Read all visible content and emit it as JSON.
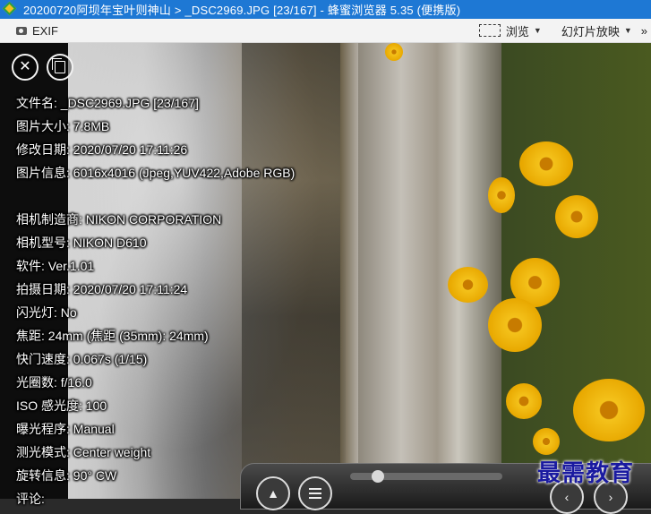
{
  "window": {
    "title": "20200720阿坝年宝叶则神山 > _DSC2969.JPG [23/167] - 蜂蜜浏览器 5.35 (便携版)"
  },
  "toolbar": {
    "exif_label": "EXIF",
    "browse_label": "浏览",
    "slideshow_label": "幻灯片放映",
    "more_label": "»"
  },
  "overlay": {
    "close_icon": "✕",
    "copy_icon": "copy-icon"
  },
  "exif": {
    "file_name": "文件名: _DSC2969.JPG [23/167]",
    "size": "图片大小: 7.8MB",
    "modified": "修改日期: 2020/07/20 17:11:26",
    "info": "图片信息: 6016x4016 (Jpeg,YUV422,Adobe RGB)",
    "maker": "相机制造商: NIKON CORPORATION",
    "model": "相机型号: NIKON D610",
    "software": "软件: Ver.1.01",
    "shot_date": "拍摄日期: 2020/07/20 17:11:24",
    "flash": "闪光灯: No",
    "focal": "焦距: 24mm (焦距 (35mm): 24mm)",
    "shutter": "快门速度: 0.067s (1/15)",
    "aperture": "光圈数: f/16.0",
    "iso": "ISO 感光度: 100",
    "program": "曝光程序: Manual",
    "metering": "测光模式: Center weight",
    "rotation": "旋转信息: 90° CW",
    "comment": "评论:"
  },
  "controls": {
    "up_icon": "▲",
    "prev_icon": "‹",
    "next_icon": "›"
  },
  "watermark": "最需教育"
}
